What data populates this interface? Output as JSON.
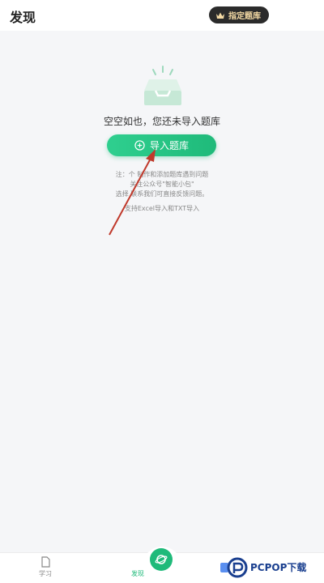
{
  "header": {
    "title": "发现",
    "assign_button": "指定题库"
  },
  "empty_state": {
    "icon": "inbox-tray-icon",
    "message": "空空如也，您还未导入题库",
    "import_button": "导入题库",
    "note_lines": [
      "注：个 制作和添加题库遇到问题",
      "关注公众号\"智能小包\"",
      "选择 联系我们可直接反馈问题。"
    ],
    "support_text": "支持Excel导入和TXT导入"
  },
  "tabbar": {
    "study_label": "学习",
    "discover_label": "发现",
    "active_color": "#1fba7a"
  },
  "watermark": {
    "text": "PCPOP下载"
  },
  "colors": {
    "accent": "#1fba7a",
    "annotation_arrow": "#c0392b",
    "badge_bg": "#2b2b2b",
    "badge_text": "#f3d9a4"
  }
}
